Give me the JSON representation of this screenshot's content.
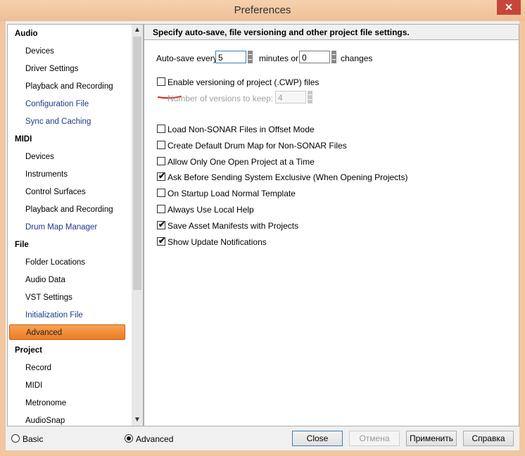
{
  "window": {
    "title": "Preferences",
    "close_glyph": "✕"
  },
  "sidebar": {
    "scroll_up_glyph": "▲",
    "scroll_down_glyph": "▼",
    "items": [
      {
        "label": "Audio"
      },
      {
        "label": "Devices"
      },
      {
        "label": "Driver Settings"
      },
      {
        "label": "Playback and Recording"
      },
      {
        "label": "Configuration File"
      },
      {
        "label": "Sync and Caching"
      },
      {
        "label": "MIDI"
      },
      {
        "label": "Devices"
      },
      {
        "label": "Instruments"
      },
      {
        "label": "Control Surfaces"
      },
      {
        "label": "Playback and Recording"
      },
      {
        "label": "Drum Map Manager"
      },
      {
        "label": "File"
      },
      {
        "label": "Folder Locations"
      },
      {
        "label": "Audio Data"
      },
      {
        "label": "VST Settings"
      },
      {
        "label": "Initialization File"
      },
      {
        "label": "Advanced"
      },
      {
        "label": "Project"
      },
      {
        "label": "Record"
      },
      {
        "label": "MIDI"
      },
      {
        "label": "Metronome"
      },
      {
        "label": "AudioSnap"
      }
    ]
  },
  "main": {
    "header": "Specify auto-save, file versioning and other project file settings.",
    "autosave": {
      "prefix": "Auto-save every",
      "minutes_value": "5",
      "minutes_suffix": "minutes or",
      "changes_value": "0",
      "changes_suffix": "changes"
    },
    "versioning": {
      "checkbox_label": "Enable versioning of project (.CWP) files",
      "checked": false,
      "keep_label": "Number of versions to keep:",
      "keep_value": "4"
    },
    "options": [
      {
        "label": "Load Non-SONAR Files in Offset Mode",
        "checked": false
      },
      {
        "label": "Create Default Drum Map for Non-SONAR Files",
        "checked": false
      },
      {
        "label": "Allow Only One Open Project at a Time",
        "checked": false
      },
      {
        "label": "Ask Before Sending System Exclusive (When Opening Projects)",
        "checked": true
      },
      {
        "label": "On Startup Load Normal Template",
        "checked": false
      },
      {
        "label": "Always Use Local Help",
        "checked": false
      },
      {
        "label": "Save Asset Manifests with Projects",
        "checked": true
      },
      {
        "label": "Show Update Notifications",
        "checked": true
      }
    ],
    "check_glyph": "✔"
  },
  "footer": {
    "mode_basic": "Basic",
    "mode_advanced": "Advanced",
    "selected_mode": "Advanced",
    "close": "Close",
    "cancel": "Отмена",
    "apply": "Применить",
    "help": "Справка"
  },
  "colors": {
    "selection": "#ee7b23",
    "link_blue": "#1b3a8c",
    "annotation_red": "#e0201c"
  }
}
